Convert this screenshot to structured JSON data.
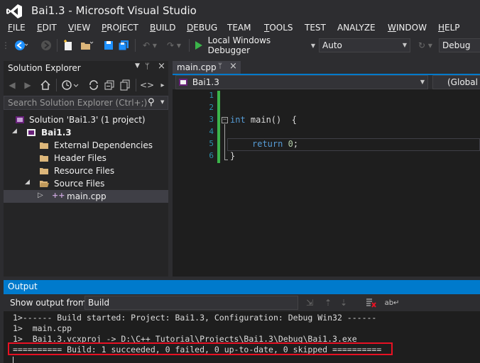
{
  "window": {
    "title": "Bai1.3 - Microsoft Visual Studio"
  },
  "menu": [
    {
      "label": "FILE",
      "u": "F",
      "rest": "ILE"
    },
    {
      "label": "EDIT",
      "u": "E",
      "rest": "DIT"
    },
    {
      "label": "VIEW",
      "u": "V",
      "rest": "IEW"
    },
    {
      "label": "PROJECT",
      "u": "P",
      "rest": "ROJECT"
    },
    {
      "label": "BUILD",
      "u": "B",
      "rest": "UILD"
    },
    {
      "label": "DEBUG",
      "u": "D",
      "rest": "EBUG"
    },
    {
      "label": "TEAM",
      "u": "",
      "rest": "TEAM"
    },
    {
      "label": "TOOLS",
      "u": "T",
      "rest": "OOLS"
    },
    {
      "label": "TEST",
      "u": "",
      "rest": "TEST"
    },
    {
      "label": "ANALYZE",
      "u": "",
      "rest": "ANALYZE"
    },
    {
      "label": "WINDOW",
      "u": "W",
      "rest": "INDOW"
    },
    {
      "label": "HELP",
      "u": "H",
      "rest": "ELP"
    }
  ],
  "toolbar": {
    "start_debugger_label": "Local Windows Debugger",
    "solution_platform": "Auto",
    "configuration": "Debug"
  },
  "solution_explorer": {
    "title": "Solution Explorer",
    "search_placeholder": "Search Solution Explorer (Ctrl+;)",
    "items": [
      {
        "label": "Solution 'Bai1.3' (1 project)"
      },
      {
        "label": "Bai1.3"
      },
      {
        "label": "External Dependencies"
      },
      {
        "label": "Header Files"
      },
      {
        "label": "Resource Files"
      },
      {
        "label": "Source Files"
      },
      {
        "label": "main.cpp"
      }
    ]
  },
  "editor": {
    "tab_label": "main.cpp",
    "nav_project": "Bai1.3",
    "nav_scope": "(Global S",
    "line_numbers": [
      "1",
      "2",
      "3",
      "4",
      "5",
      "6"
    ],
    "code": {
      "kw_int": "int",
      "fn": " main()  {",
      "kw_return": "return",
      "ret_value": "0",
      "ret_end": ";",
      "close": "}"
    }
  },
  "output": {
    "title": "Output",
    "show_from_label": "Show output from:",
    "source": "Build",
    "lines": [
      "1>------ Build started: Project: Bai1.3, Configuration: Debug Win32 ------",
      "1>  main.cpp",
      "1>  Bai1.3.vcxproj -> D:\\C++ Tutorial\\Projects\\Bai1.3\\Debug\\Bai1.3.exe",
      "========== Build: 1 succeeded, 0 failed, 0 up-to-date, 0 skipped =========="
    ]
  },
  "colors": {
    "accent": "#007acc",
    "highlight_box": "#e81123",
    "vs_purple": "#68217a",
    "play_green": "#3bb44a"
  }
}
